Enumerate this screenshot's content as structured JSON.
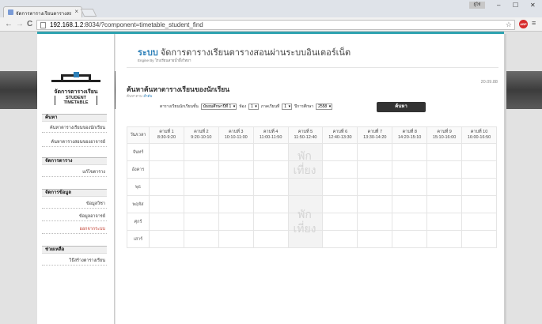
{
  "browser": {
    "tab_title": "จัดการตารางเรียนตารางสอนผ่า",
    "tab_close": "×",
    "user_badge": "ผู้ใช้",
    "url_host": "192.168.1.2",
    "url_rest": ":8034/?component=timetable_student_find",
    "abp": "ABP",
    "icons": {
      "back": "←",
      "forward": "→",
      "reload": "C",
      "star": "☆",
      "menu": "≡",
      "minimize": "–",
      "maximize": "☐",
      "close": "✕"
    }
  },
  "sidebar": {
    "logo_th": "จัดการตารางเรียน",
    "logo_en": "STUDENT TIMETABLE",
    "sections": [
      {
        "title": "ค้นหา",
        "links": [
          "ค้นหาตารางเรียนของนักเรียน",
          "ค้นหาตารางสอนของอาจารย์"
        ]
      },
      {
        "title": "จัดการตาราง",
        "links": [
          "แก้ไขตาราง"
        ]
      },
      {
        "title": "จัดการข้อมูล",
        "links": [
          "ข้อมูลวิชา",
          "ข้อมูลอาจารย์",
          "ออกจากระบบ"
        ]
      },
      {
        "title": "ช่วยเหลือ",
        "links": [
          "วิธีสร้างตารางเรียน"
        ]
      }
    ]
  },
  "header": {
    "brand": "ระบบ",
    "title": "จัดการตารางเรียนตารางสอนผ่านระบบอินเตอร์เน็ต",
    "subtitle": "Engine By โรงเรียนสายน้ำผึ้งวิทยา",
    "date": "20.09.88"
  },
  "content": {
    "heading": "ค้นหาค้นหาตารางเรียนของนักเรียน",
    "crumb_prefix": "ค้นหาตาม",
    "crumb_link": "ลำดับ",
    "filter": {
      "level_label": "ตารางเรียนนักเรียนชั้น",
      "level_value": "มัธยมศึกษาปีที่ 1",
      "room_label": "ห้อง",
      "room_value": "1",
      "term_label": "ภาคเรียนที่",
      "term_value": "1",
      "year_label": "ปีการศึกษา",
      "year_value": "2558"
    },
    "search_button": "ค้นหา"
  },
  "timetable": {
    "corner": "วัน/เวลา",
    "periods": [
      {
        "label": "คาบที่ 1",
        "time": "8:30-9:20"
      },
      {
        "label": "คาบที่ 2",
        "time": "9:20-10:10"
      },
      {
        "label": "คาบที่ 3",
        "time": "10:10-11:00"
      },
      {
        "label": "คาบที่ 4",
        "time": "11:00-11:50"
      },
      {
        "label": "คาบที่ 5",
        "time": "11:50-12:40"
      },
      {
        "label": "คาบที่ 6",
        "time": "12:40-13:30"
      },
      {
        "label": "คาบที่ 7",
        "time": "13:30-14:20"
      },
      {
        "label": "คาบที่ 8",
        "time": "14:20-15:10"
      },
      {
        "label": "คาบที่ 9",
        "time": "15:10-16:00"
      },
      {
        "label": "คาบที่ 10",
        "time": "16:00-16:50"
      }
    ],
    "days": [
      "จันทร์",
      "อังคาร",
      "พุธ",
      "พฤหัส",
      "ศุกร์",
      "เสาร์"
    ],
    "lunch_text": [
      "พัก",
      "เที่ยง"
    ]
  }
}
